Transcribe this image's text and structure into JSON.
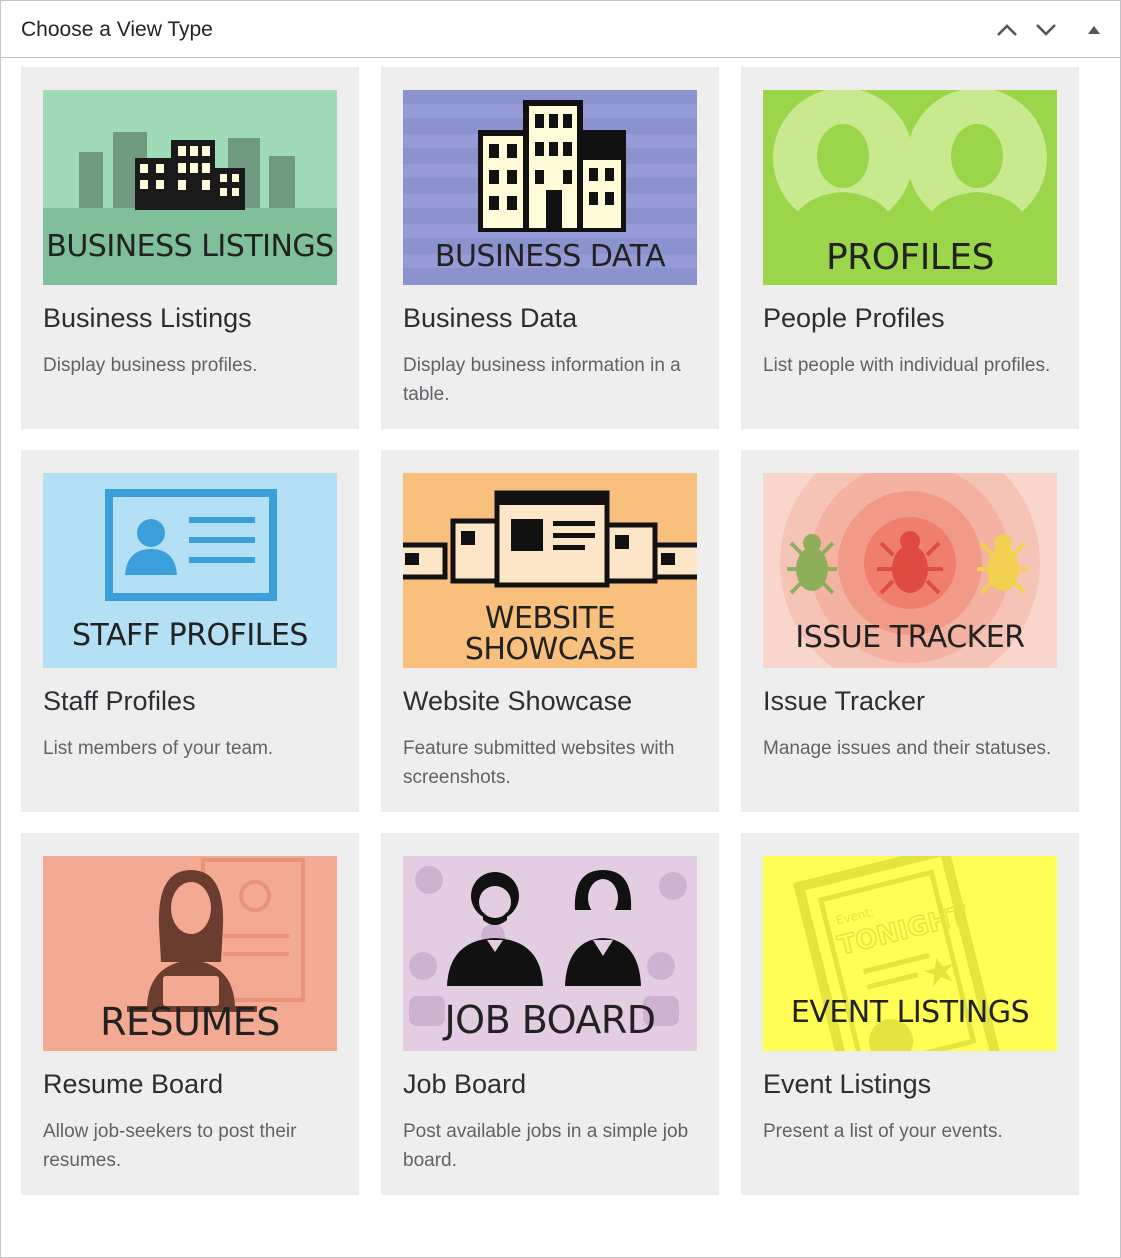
{
  "panel": {
    "title": "Choose a View Type",
    "controls": [
      {
        "name": "move-up-icon"
      },
      {
        "name": "move-down-icon"
      },
      {
        "name": "collapse-toggle-icon"
      }
    ]
  },
  "cards": [
    {
      "label": "BUSINESS LISTINGS",
      "title": "Business Listings",
      "desc": "Display business profiles.",
      "color": "#9fdbb7",
      "icon": "buildings-icon"
    },
    {
      "label": "BUSINESS DATA",
      "title": "Business Data",
      "desc": "Display business information in a table.",
      "color": "#8b93cf",
      "icon": "office-building-icon"
    },
    {
      "label": "PROFILES",
      "title": "People Profiles",
      "desc": "List people with individual profiles.",
      "color": "#9bd64a",
      "icon": "people-profile-icon"
    },
    {
      "label": "STAFF PROFILES",
      "title": "Staff Profiles",
      "desc": "List members of your team.",
      "color": "#b4e0f6",
      "icon": "id-card-icon"
    },
    {
      "label_line1": "WEBSITE",
      "label_line2": "SHOWCASE",
      "title": "Website Showcase",
      "desc": "Feature submitted websites with screenshots.",
      "color": "#f9bf7c",
      "icon": "browser-windows-icon"
    },
    {
      "label": "ISSUE TRACKER",
      "title": "Issue Tracker",
      "desc": "Manage issues and their statuses.",
      "color": "#f8d6cc",
      "icon": "bug-icon"
    },
    {
      "label": "RESUMES",
      "title": "Resume Board",
      "desc": "Allow job-seekers to post their resumes.",
      "color": "#f4aa92",
      "icon": "person-laptop-icon"
    },
    {
      "label": "JOB BOARD",
      "title": "Job Board",
      "desc": "Post available jobs in a simple job board.",
      "color": "#e2cde3",
      "icon": "job-seekers-icon"
    },
    {
      "label": "EVENT LISTINGS",
      "title": "Event Listings",
      "desc": "Present a list of your events.",
      "color": "#fefe55",
      "icon": "event-ticket-icon",
      "ticket_kicker": "Event:",
      "ticket_headline": "TONIGHT"
    }
  ]
}
